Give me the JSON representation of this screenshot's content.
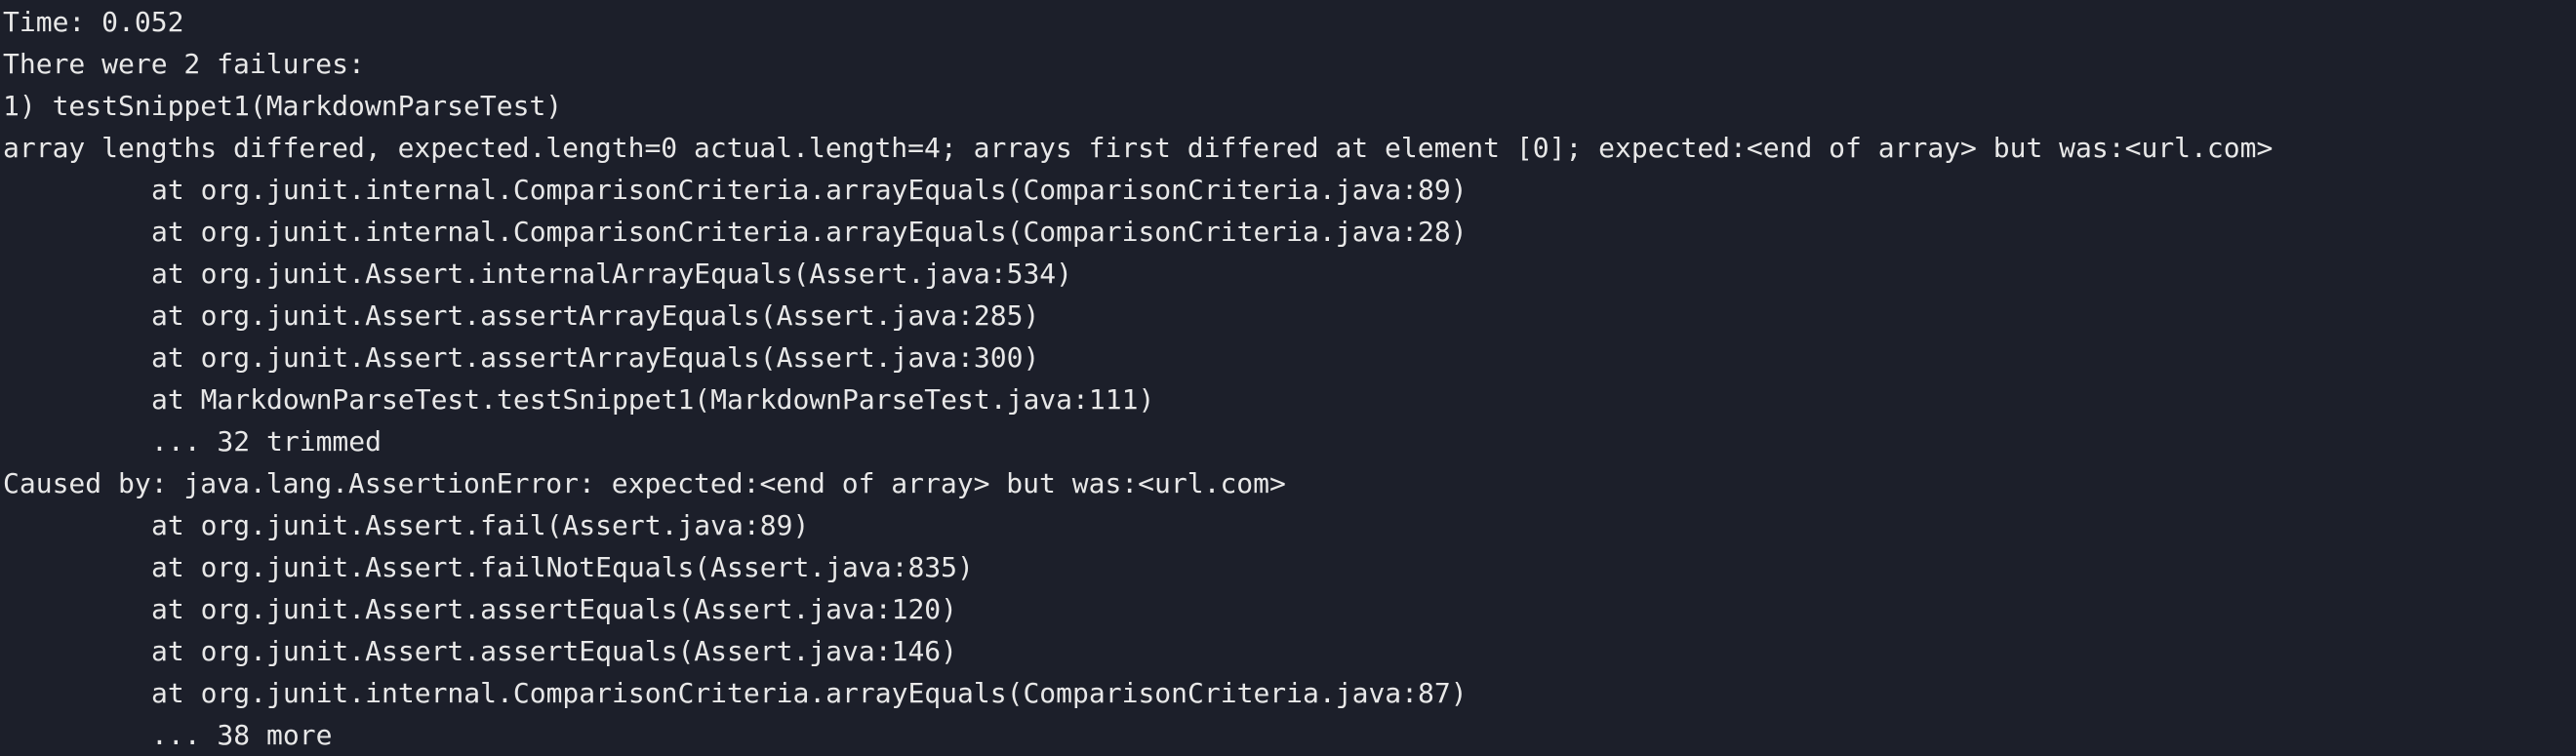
{
  "terminal": {
    "lines": [
      {
        "indent": false,
        "text": "Time: 0.052"
      },
      {
        "indent": false,
        "text": "There were 2 failures:"
      },
      {
        "indent": false,
        "text": "1) testSnippet1(MarkdownParseTest)"
      },
      {
        "indent": false,
        "text": "array lengths differed, expected.length=0 actual.length=4; arrays first differed at element [0]; expected:<end of array> but was:<url.com>"
      },
      {
        "indent": true,
        "text": "at org.junit.internal.ComparisonCriteria.arrayEquals(ComparisonCriteria.java:89)"
      },
      {
        "indent": true,
        "text": "at org.junit.internal.ComparisonCriteria.arrayEquals(ComparisonCriteria.java:28)"
      },
      {
        "indent": true,
        "text": "at org.junit.Assert.internalArrayEquals(Assert.java:534)"
      },
      {
        "indent": true,
        "text": "at org.junit.Assert.assertArrayEquals(Assert.java:285)"
      },
      {
        "indent": true,
        "text": "at org.junit.Assert.assertArrayEquals(Assert.java:300)"
      },
      {
        "indent": true,
        "text": "at MarkdownParseTest.testSnippet1(MarkdownParseTest.java:111)"
      },
      {
        "indent": true,
        "text": "... 32 trimmed"
      },
      {
        "indent": false,
        "text": "Caused by: java.lang.AssertionError: expected:<end of array> but was:<url.com>"
      },
      {
        "indent": true,
        "text": "at org.junit.Assert.fail(Assert.java:89)"
      },
      {
        "indent": true,
        "text": "at org.junit.Assert.failNotEquals(Assert.java:835)"
      },
      {
        "indent": true,
        "text": "at org.junit.Assert.assertEquals(Assert.java:120)"
      },
      {
        "indent": true,
        "text": "at org.junit.Assert.assertEquals(Assert.java:146)"
      },
      {
        "indent": true,
        "text": "at org.junit.internal.ComparisonCriteria.arrayEquals(ComparisonCriteria.java:87)"
      },
      {
        "indent": true,
        "text": "... 38 more"
      }
    ]
  }
}
